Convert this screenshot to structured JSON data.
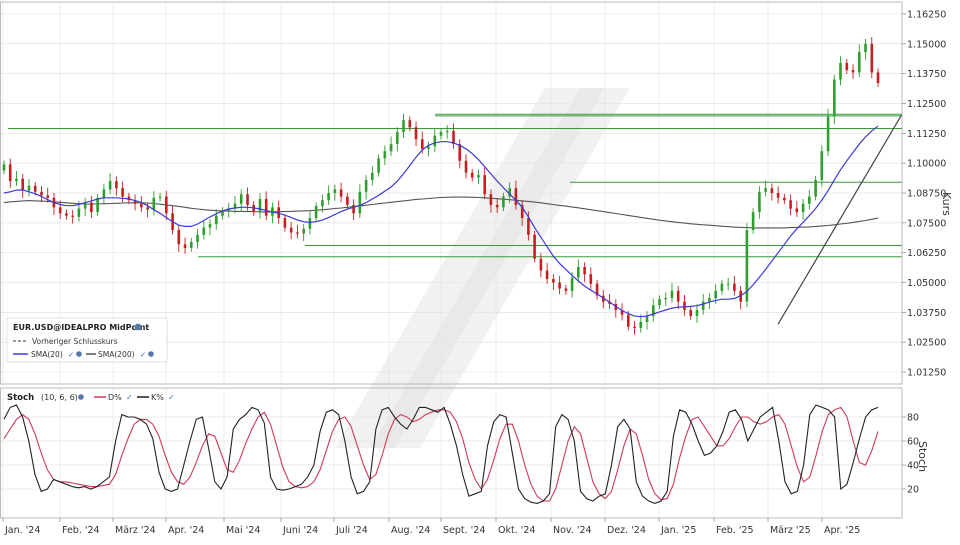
{
  "chart_data": [
    {
      "type": "line",
      "subtype": "candlestick",
      "title": "EUR.USD@IDEALPRO MidPoint",
      "ylabel": "Kurs",
      "ylim": [
        1.0075,
        1.1675
      ],
      "y_ticks": [
        "1.16250",
        "1.15000",
        "1.13750",
        "1.12500",
        "1.11250",
        "1.10000",
        "1.08750",
        "1.07500",
        "1.06250",
        "1.05000",
        "1.03750",
        "1.02500",
        "1.01250"
      ],
      "x_ticks": [
        "Jan. '24",
        "Feb. '24",
        "März '24",
        "Apr. '24",
        "Mai '24",
        "Juni '24",
        "Juli '24",
        "Aug. '24",
        "Sept. '24",
        "Okt. '24",
        "Nov. '24",
        "Dez. '24",
        "Jan. '25",
        "Feb. '25",
        "März '25",
        "Apr. '25"
      ],
      "legend": {
        "placement": "bottom-left",
        "title": "EUR.USD@IDEALPRO MidPoint",
        "items": [
          "Vorheriger Schlusskurs",
          "SMA(20)",
          "SMA(200)"
        ]
      },
      "grid": true,
      "series": [
        {
          "name": "EUR.USD@IDEALPRO MidPoint",
          "kind": "candle",
          "values": [
            1.0995,
            1.0925,
            1.0935,
            1.0885,
            1.0905,
            1.088,
            1.0865,
            1.0855,
            1.0815,
            1.079,
            1.078,
            1.0775,
            1.081,
            1.0835,
            1.0795,
            1.0855,
            1.089,
            1.0925,
            1.0895,
            1.086,
            1.0845,
            1.083,
            1.0815,
            1.0805,
            1.0855,
            1.086,
            1.079,
            1.072,
            1.066,
            1.0645,
            1.067,
            1.07,
            1.073,
            1.0745,
            1.078,
            1.08,
            1.081,
            1.083,
            1.087,
            1.0825,
            1.0795,
            1.085,
            1.078,
            1.0815,
            1.077,
            1.073,
            1.071,
            1.0705,
            1.0725,
            1.077,
            1.082,
            1.0845,
            1.0875,
            1.089,
            1.086,
            1.0825,
            1.079,
            1.088,
            1.093,
            1.096,
            1.102,
            1.105,
            1.108,
            1.113,
            1.118,
            1.115,
            1.11,
            1.106,
            1.107,
            1.1115,
            1.113,
            1.1135,
            1.108,
            1.101,
            1.096,
            1.094,
            1.095,
            1.087,
            1.0825,
            1.0815,
            1.086,
            1.0895,
            1.0825,
            1.077,
            1.07,
            1.06,
            1.055,
            1.0515,
            1.05,
            1.0475,
            1.0465,
            1.052,
            1.0565,
            1.0535,
            1.0495,
            1.0445,
            1.042,
            1.041,
            1.0385,
            1.0365,
            1.0315,
            1.031,
            1.0335,
            1.036,
            1.0405,
            1.043,
            1.0435,
            1.0465,
            1.042,
            1.0385,
            1.036,
            1.0385,
            1.042,
            1.0435,
            1.0465,
            1.0495,
            1.0495,
            1.0465,
            1.042,
            1.072,
            1.0795,
            1.088,
            1.0895,
            1.0875,
            1.0855,
            1.0845,
            1.081,
            1.0795,
            1.083,
            1.086,
            1.093,
            1.105,
            1.1195,
            1.135,
            1.142,
            1.139,
            1.138,
            1.1465,
            1.15,
            1.138,
            1.1335
          ]
        },
        {
          "name": "SMA(20)",
          "kind": "line",
          "values": [
            1.0875,
            1.088,
            1.0887,
            1.0888,
            1.088,
            1.0872,
            1.086,
            1.0847,
            1.0835,
            1.0827,
            1.0822,
            1.0822,
            1.0827,
            1.0835,
            1.0842,
            1.085,
            1.0855,
            1.0855,
            1.0855,
            1.0853,
            1.085,
            1.0843,
            1.0835,
            1.0822,
            1.0805,
            1.079,
            1.0772,
            1.0755,
            1.074,
            1.0735,
            1.0735,
            1.0745,
            1.076,
            1.0775,
            1.0788,
            1.08,
            1.0808,
            1.0812,
            1.0815,
            1.0815,
            1.0813,
            1.0808,
            1.0802,
            1.0795,
            1.079,
            1.0782,
            1.0773,
            1.0762,
            1.0755,
            1.0752,
            1.0755,
            1.0762,
            1.0772,
            1.0785,
            1.0797,
            1.0807,
            1.0815,
            1.0823,
            1.0835,
            1.085,
            1.0865,
            1.0883,
            1.09,
            1.0925,
            1.0955,
            1.099,
            1.1025,
            1.1055,
            1.1075,
            1.1085,
            1.109,
            1.109,
            1.1085,
            1.1075,
            1.106,
            1.104,
            1.1015,
            1.0985,
            1.0955,
            1.0925,
            1.0897,
            1.087,
            1.0845,
            1.0815,
            1.0775,
            1.073,
            1.069,
            1.065,
            1.061,
            1.058,
            1.0555,
            1.053,
            1.0507,
            1.0485,
            1.0468,
            1.0452,
            1.0435,
            1.0418,
            1.04,
            1.0383,
            1.037,
            1.036,
            1.0357,
            1.036,
            1.0368,
            1.0377,
            1.0385,
            1.0393,
            1.0397,
            1.0398,
            1.04,
            1.0403,
            1.041,
            1.0418,
            1.0425,
            1.043,
            1.043,
            1.0433,
            1.0445,
            1.0463,
            1.049,
            1.0522,
            1.0555,
            1.059,
            1.0625,
            1.066,
            1.0695,
            1.0725,
            1.0752,
            1.078,
            1.081,
            1.0845,
            1.0885,
            1.093,
            1.0972,
            1.101,
            1.1045,
            1.108,
            1.111,
            1.1135,
            1.1155
          ]
        },
        {
          "name": "SMA(200)",
          "kind": "line",
          "values": [
            1.0835,
            1.0838,
            1.084,
            1.0842,
            1.0843,
            1.0842,
            1.0841,
            1.084,
            1.0838,
            1.0836,
            1.0834,
            1.0832,
            1.083,
            1.0829,
            1.0829,
            1.0829,
            1.083,
            1.0831,
            1.0832,
            1.0833,
            1.0834,
            1.0834,
            1.0834,
            1.0833,
            1.0831,
            1.0828,
            1.0825,
            1.0822,
            1.0819,
            1.0815,
            1.0811,
            1.0808,
            1.0805,
            1.0803,
            1.0801,
            1.08,
            1.0799,
            1.0798,
            1.0798,
            1.0797,
            1.0797,
            1.0796,
            1.0796,
            1.0796,
            1.0797,
            1.0797,
            1.0798,
            1.0799,
            1.08,
            1.0801,
            1.0803,
            1.0805,
            1.0807,
            1.081,
            1.0812,
            1.0815,
            1.0818,
            1.0821,
            1.0824,
            1.0827,
            1.083,
            1.0833,
            1.0836,
            1.0839,
            1.0842,
            1.0845,
            1.0848,
            1.085,
            1.0852,
            1.0854,
            1.0856,
            1.0857,
            1.0858,
            1.0858,
            1.0858,
            1.0857,
            1.0856,
            1.0855,
            1.0853,
            1.0851,
            1.0849,
            1.0847,
            1.0845,
            1.0842,
            1.084,
            1.0837,
            1.0834,
            1.083,
            1.0827,
            1.0823,
            1.082,
            1.0816,
            1.0813,
            1.0809,
            1.0805,
            1.0801,
            1.0797,
            1.0793,
            1.0789,
            1.0785,
            1.0781,
            1.0777,
            1.0773,
            1.0769,
            1.0765,
            1.0761,
            1.0758,
            1.0755,
            1.0752,
            1.0749,
            1.0746,
            1.0744,
            1.0742,
            1.074,
            1.0738,
            1.0736,
            1.0734,
            1.0732,
            1.0731,
            1.073,
            1.0729,
            1.0729,
            1.0729,
            1.0729,
            1.0729,
            1.0729,
            1.073,
            1.0731,
            1.0732,
            1.0733,
            1.0735,
            1.0737,
            1.0739,
            1.0742,
            1.0745,
            1.0748,
            1.0752,
            1.0756,
            1.076,
            1.0765,
            1.077
          ]
        }
      ]
    },
    {
      "type": "line",
      "title": "Stoch",
      "parameters": "(10, 6, 6)",
      "ylabel": "Stoch",
      "ylim": [
        0,
        100
      ],
      "y_ticks": [
        "80",
        "60",
        "40",
        "20"
      ],
      "legend": {
        "placement": "top-left",
        "items": [
          "D%",
          "K%"
        ]
      },
      "series": [
        {
          "name": "K%",
          "values": [
            78,
            88,
            90,
            80,
            60,
            32,
            18,
            20,
            28,
            26,
            24,
            22,
            21,
            22,
            20,
            22,
            26,
            30,
            60,
            82,
            80,
            80,
            78,
            74,
            62,
            34,
            20,
            18,
            20,
            40,
            60,
            78,
            80,
            54,
            26,
            20,
            30,
            70,
            78,
            82,
            88,
            86,
            75,
            30,
            20,
            19,
            20,
            22,
            24,
            30,
            40,
            68,
            84,
            86,
            82,
            60,
            30,
            16,
            18,
            26,
            70,
            86,
            88,
            80,
            74,
            70,
            78,
            88,
            88,
            86,
            84,
            88,
            74,
            56,
            32,
            14,
            16,
            18,
            56,
            76,
            82,
            80,
            50,
            20,
            12,
            9,
            8,
            10,
            16,
            72,
            82,
            78,
            60,
            18,
            12,
            10,
            14,
            16,
            40,
            72,
            78,
            70,
            26,
            14,
            10,
            8,
            10,
            18,
            64,
            86,
            84,
            74,
            60,
            48,
            50,
            56,
            68,
            84,
            86,
            78,
            60,
            70,
            80,
            84,
            88,
            60,
            26,
            16,
            18,
            40,
            82,
            90,
            88,
            86,
            80,
            20,
            24,
            42,
            62,
            80,
            86,
            88
          ]
        },
        {
          "name": "D%",
          "values": [
            62,
            70,
            78,
            82,
            78,
            66,
            50,
            36,
            28,
            26,
            26,
            25,
            24,
            23,
            22,
            22,
            23,
            24,
            32,
            48,
            62,
            74,
            78,
            78,
            74,
            64,
            48,
            34,
            26,
            24,
            30,
            42,
            56,
            66,
            64,
            50,
            36,
            34,
            44,
            58,
            70,
            80,
            84,
            74,
            56,
            38,
            26,
            22,
            21,
            22,
            26,
            36,
            52,
            68,
            78,
            80,
            72,
            56,
            40,
            28,
            32,
            48,
            66,
            78,
            82,
            80,
            76,
            78,
            82,
            84,
            86,
            86,
            84,
            76,
            62,
            42,
            28,
            20,
            28,
            44,
            62,
            74,
            74,
            60,
            40,
            24,
            14,
            10,
            10,
            20,
            40,
            60,
            72,
            66,
            46,
            26,
            16,
            12,
            18,
            36,
            56,
            70,
            66,
            48,
            28,
            16,
            11,
            12,
            24,
            46,
            64,
            78,
            80,
            72,
            64,
            56,
            56,
            62,
            72,
            80,
            80,
            76,
            74,
            76,
            80,
            82,
            74,
            56,
            38,
            26,
            30,
            48,
            68,
            82,
            86,
            88,
            80,
            60,
            42,
            40,
            52,
            68
          ]
        }
      ]
    }
  ],
  "legend_ui": {
    "instrument": "EUR.USD@IDEALPRO MidPoint",
    "prev_close_label": "Vorheriger Schlusskurs",
    "sma20_label": "SMA(20)",
    "sma200_label": "SMA(200)",
    "stoch_label": "Stoch",
    "stoch_params": "(10, 6, 6)",
    "d_label": "D%",
    "k_label": "K%",
    "kurs_label": "Kurs",
    "stoch_axis_label": "Stoch"
  },
  "colors": {
    "candle_up": "#2e9e2e",
    "candle_down": "#c42020",
    "sma20": "#3b3bd8",
    "sma200": "#555555",
    "k_line": "#222222",
    "d_line": "#d03a5a",
    "support_lines": "#3a9a3a",
    "trend_line": "#444444",
    "grid": "#e4e4e4"
  },
  "support_levels": [
    1.1205,
    1.1198,
    1.1145,
    1.092,
    1.0655,
    1.0608
  ],
  "trend_line": {
    "from": 1.0325,
    "to": 1.1205
  }
}
